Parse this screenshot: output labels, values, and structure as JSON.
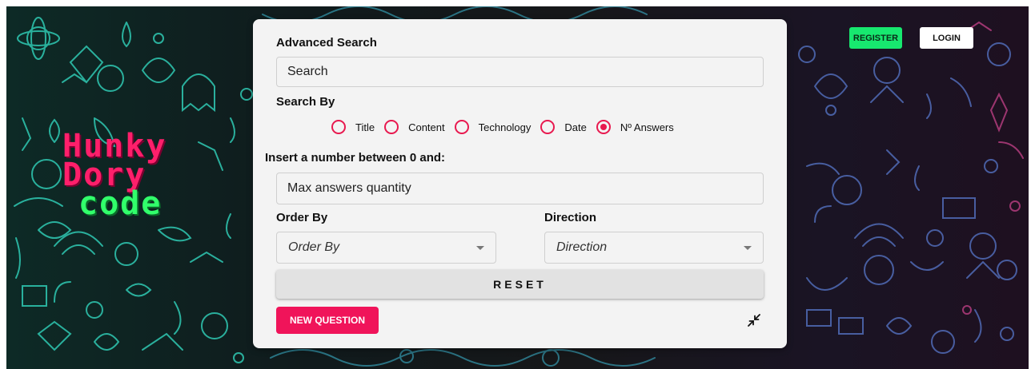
{
  "header": {
    "register_label": "REGISTER",
    "login_label": "LOGIN"
  },
  "logo": {
    "line1": "Hunky",
    "line2": "Dory",
    "line3": "code"
  },
  "search": {
    "title": "Advanced Search",
    "search_placeholder": "Search",
    "search_by_label": "Search By",
    "options": [
      {
        "label": "Title",
        "selected": false
      },
      {
        "label": "Content",
        "selected": false
      },
      {
        "label": "Technology",
        "selected": false
      },
      {
        "label": "Date",
        "selected": false
      },
      {
        "label": "Nº Answers",
        "selected": true
      }
    ],
    "number_label": "Insert a number between 0 and:",
    "number_placeholder": "Max answers quantity",
    "order_by_label": "Order By",
    "order_by_value": "Order By",
    "direction_label": "Direction",
    "direction_value": "Direction",
    "reset_label": "RESET",
    "new_question_label": "NEW QUESTION"
  },
  "colors": {
    "accent": "#e8194f",
    "register_green": "#17e86f",
    "logo_pink": "#ff1f6b",
    "logo_green": "#31ff6b"
  },
  "icons": {
    "collapse": "collapse-icon"
  }
}
